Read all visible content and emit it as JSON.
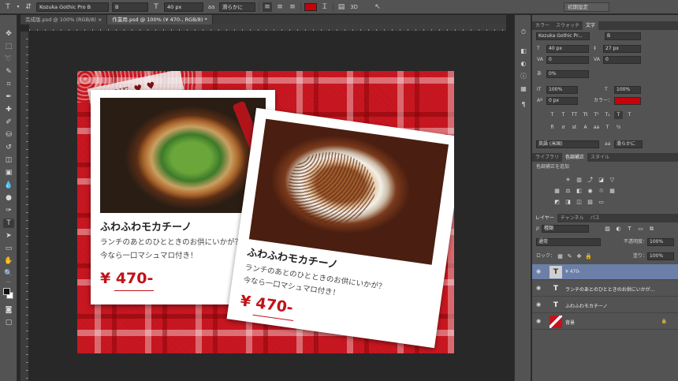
{
  "options_bar": {
    "tool_icon": "type-tool-icon",
    "orientation_icon": "type-orientation-icon",
    "font_family": "Kozuka Gothic Pro B",
    "font_style": "B",
    "font_size": "40 px",
    "aa_label": "aa",
    "antialias": "滑らかに",
    "text_color": "#c8000a",
    "workspace": "初期設定"
  },
  "tabs": [
    {
      "label": "完成版.psd @ 100% (RGB/8)  ×"
    },
    {
      "label": "作業用.psd @ 100% (¥ 470-, RGB/8) *"
    }
  ],
  "document": {
    "love_tag": "LOVE",
    "card1": {
      "title": "ふわふわモカチーノ",
      "desc_line1": "ランチのあとのひとときのお供にいかが？",
      "desc_line2": "今なら一口マシュマロ付き！",
      "price": "¥ 470-"
    },
    "card2": {
      "title": "ふわふわモカチーノ",
      "desc_line1": "ランチのあとのひとときのお供にいかが？",
      "desc_line2": "今なら一口マシュマロ付き！",
      "price": "¥ 470-"
    }
  },
  "character_panel": {
    "tabs": [
      "カラー",
      "スウォッチ",
      "文字"
    ],
    "font_family": "Kozuka Gothic Pr...",
    "font_style": "B",
    "size": "40 px",
    "leading": "27 px",
    "kerning": "0",
    "tracking": "0",
    "tsume": "0%",
    "vscale": "100%",
    "hscale": "100%",
    "baseline": "0 px",
    "color_label": "カラー：",
    "color": "#c8000a",
    "language": "英語 (米国)",
    "aa": "滑らかに",
    "aa_label": "aa"
  },
  "adjust_panel": {
    "tabs": [
      "ライブラリ",
      "色調補正",
      "スタイル"
    ],
    "heading": "色調補正を追加"
  },
  "layers_panel": {
    "tabs": [
      "レイヤー",
      "チャンネル",
      "パス"
    ],
    "filter": "種類",
    "blend_mode": "通常",
    "opacity_label": "不透明度：",
    "opacity": "100%",
    "lock_label": "ロック：",
    "fill_label": "塗り：",
    "fill": "100%",
    "layers": [
      {
        "name": "¥ 470-",
        "type": "T"
      },
      {
        "name": "ランチのあとのひとときのお供にいかが...",
        "type": "T"
      },
      {
        "name": "ふわふわモカチーノ",
        "type": "T"
      },
      {
        "name": "背景",
        "type": ""
      }
    ]
  }
}
